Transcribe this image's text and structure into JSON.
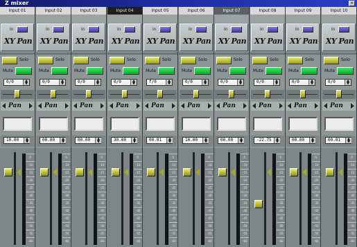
{
  "window": {
    "title": "Z mixer",
    "close_label": "×"
  },
  "labels": {
    "in": "In",
    "xy_pan": "XY Pan",
    "solo": "Solo",
    "mute": "Mute",
    "pan": "Pan"
  },
  "colors": {
    "solo": "#d6d84a",
    "mute": "#22d24a",
    "in_button": "#5a4ec0",
    "fader_knob": "#c9cb3a",
    "titlebar": "#1c2a9a"
  },
  "channels": [
    {
      "name": "Input 01",
      "pan": "0/0",
      "volume": "10.00",
      "fader_level": 0.0
    },
    {
      "name": "Input 02",
      "pan": "0/0",
      "volume": "00.00",
      "fader_level": 0.0
    },
    {
      "name": "Input 03",
      "pan": "0/0",
      "volume": "00.00",
      "fader_level": 0.0
    },
    {
      "name": "Input 04",
      "pan": "0/0",
      "volume": "30.00",
      "fader_level": 0.0
    },
    {
      "name": "Input 05",
      "pan": "f/0",
      "volume": "00.01",
      "fader_level": 0.0
    },
    {
      "name": "Input 06",
      "pan": "0/0",
      "volume": "10.00",
      "fader_level": 0.0
    },
    {
      "name": "Input 07",
      "pan": "0/0",
      "volume": "00.00",
      "fader_level": 0.0
    },
    {
      "name": "Input 08",
      "pan": "0/0",
      "volume": "-22.75",
      "fader_level": -22.75
    },
    {
      "name": "Input 09",
      "pan": "0/0",
      "volume": "00.00",
      "fader_level": 0.0
    },
    {
      "name": "Input 10",
      "pan": "0/0",
      "volume": "00.01",
      "fader_level": 0.0
    }
  ],
  "scale": [
    "-5",
    "-10",
    "-15",
    "-20",
    "-25",
    "-30",
    "-35",
    "-40",
    "-45",
    "-50",
    "-55",
    "-60"
  ]
}
